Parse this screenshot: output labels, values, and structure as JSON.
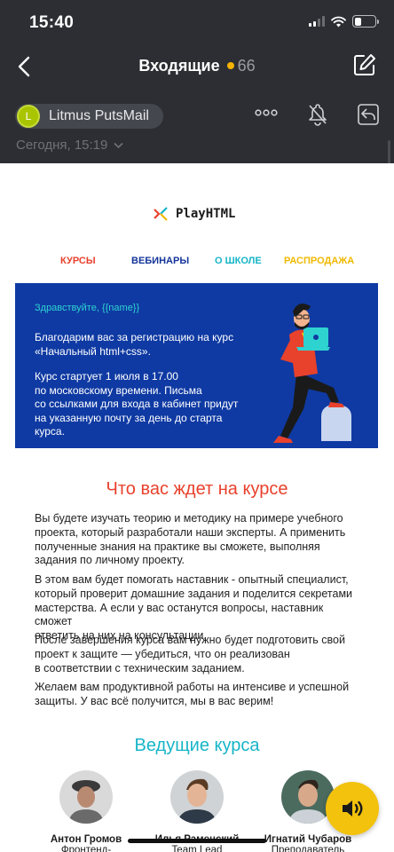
{
  "status_bar": {
    "time": "15:40"
  },
  "nav": {
    "title": "Входящие",
    "unread_count": "66",
    "unread_dot_color": "#f5b400"
  },
  "message": {
    "sender_initial": "L",
    "sender_name": "Litmus PutsMail",
    "date": "Сегодня, 15:19"
  },
  "email": {
    "brand": "PlayHTML",
    "menu": [
      {
        "label": "КУРСЫ",
        "color": "#e8412c"
      },
      {
        "label": "ВЕБИНАРЫ",
        "color": "#13349a"
      },
      {
        "label": "О ШКОЛЕ",
        "color": "#16b5c7"
      },
      {
        "label": "РАСПРОДАЖА",
        "color": "#f0b800"
      }
    ],
    "hero": {
      "greeting": "Здравствуйте, {{name}}",
      "lines_1": [
        "Благодарим вас за регистрацию на курс",
        "«Начальный html+css»."
      ],
      "lines_2": [
        "Курс стартует 1 июля в 17.00",
        "по московскому времени. Письма",
        "со ссылками для входа в кабинет придут",
        "на указанную почту за день до старта",
        "курса."
      ]
    },
    "about_title": "Что вас ждет на курсе",
    "paragraphs": [
      [
        "Вы будете изучать теорию и методику на примере учебного",
        "проекта, который разработали наши эксперты. А применить",
        "полученные знания на практике вы сможете, выполняя",
        "задания по личному проекту."
      ],
      [
        "В этом вам будет помогать наставник - опытный специалист,",
        "который проверит домашние задания и поделится секретами",
        "мастерства. А если у вас останутся вопросы, наставник сможет",
        "ответить на них на консультации."
      ],
      [
        "После завершения курса вам нужно будет подготовить свой",
        "проект к защите — убедиться, что он реализован",
        "в соответствии с техническим заданием."
      ],
      [
        "Желаем вам продуктивной работы на интенсиве и успешной",
        "защиты. У вас всё получится, мы в вас верим!"
      ]
    ],
    "speakers_title": "Ведущие курса",
    "speakers": [
      {
        "name": "Антон Громов",
        "role": "Фронтенд-"
      },
      {
        "name": "Илья Раменский",
        "role": "Team Lead"
      },
      {
        "name": "Игнатий Чубаров",
        "role": "Преподаватель"
      }
    ]
  },
  "colors": {
    "header_bg": "#2c2e33",
    "accent_red": "#e8412c",
    "accent_teal": "#16b5c7",
    "hero_bg": "#0f3aa3",
    "fab": "#f2c20c"
  },
  "icons": [
    "back-chevron-icon",
    "compose-icon",
    "more-dots-icon",
    "silence-icon",
    "reply-icon",
    "chevron-down-icon",
    "speaker-icon"
  ]
}
